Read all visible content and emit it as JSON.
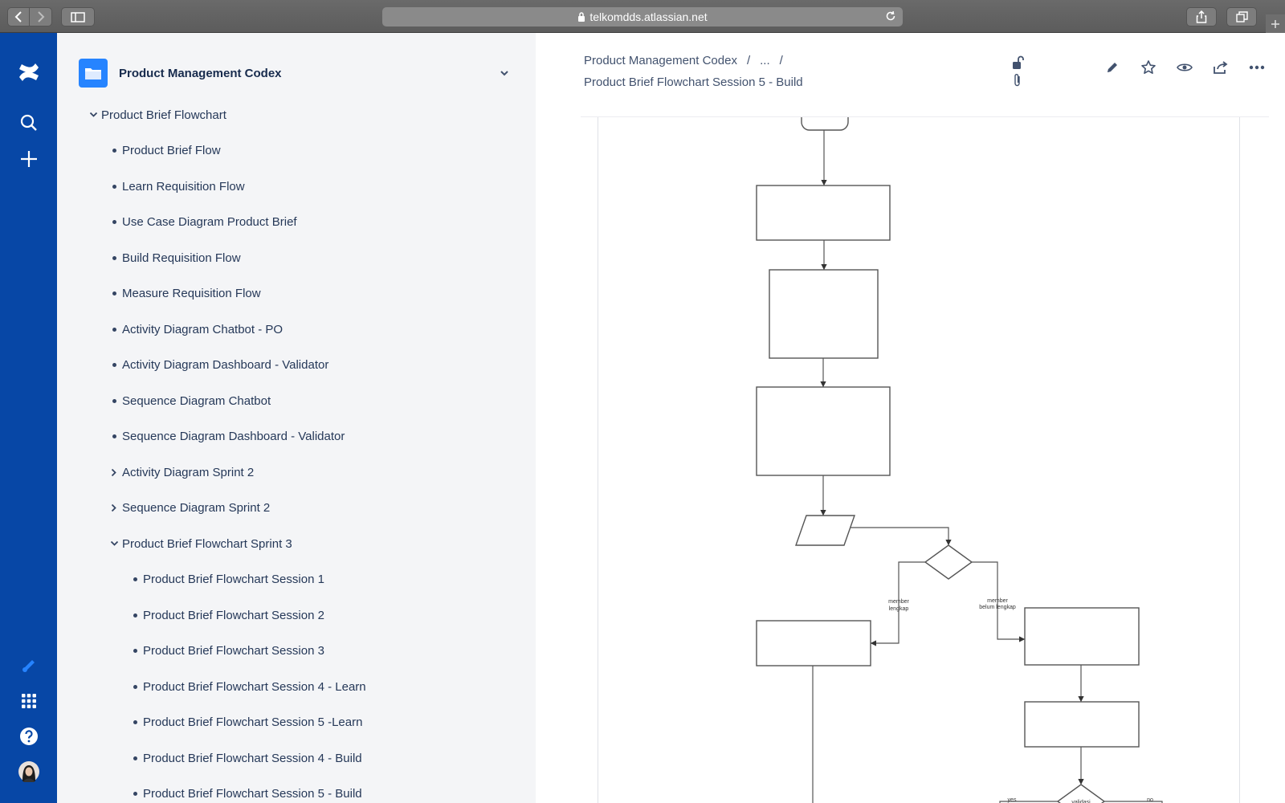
{
  "browser": {
    "url": "telkomdds.atlassian.net"
  },
  "space": {
    "title": "Product Management Codex"
  },
  "tree": [
    {
      "label": "Product Brief Flowchart",
      "level": 0,
      "marker": "chevron-down"
    },
    {
      "label": "Product Brief Flow",
      "level": 1,
      "marker": "bullet"
    },
    {
      "label": "Learn Requisition Flow",
      "level": 1,
      "marker": "bullet"
    },
    {
      "label": "Use Case Diagram Product Brief",
      "level": 1,
      "marker": "bullet"
    },
    {
      "label": "Build Requisition Flow",
      "level": 1,
      "marker": "bullet"
    },
    {
      "label": "Measure Requisition Flow",
      "level": 1,
      "marker": "bullet"
    },
    {
      "label": "Activity Diagram Chatbot - PO",
      "level": 1,
      "marker": "bullet"
    },
    {
      "label": "Activity Diagram Dashboard - Validator",
      "level": 1,
      "marker": "bullet"
    },
    {
      "label": "Sequence Diagram Chatbot",
      "level": 1,
      "marker": "bullet"
    },
    {
      "label": "Sequence Diagram Dashboard - Validator",
      "level": 1,
      "marker": "bullet"
    },
    {
      "label": "Activity Diagram Sprint 2",
      "level": 1,
      "marker": "chevron-right"
    },
    {
      "label": "Sequence Diagram Sprint 2",
      "level": 1,
      "marker": "chevron-right"
    },
    {
      "label": "Product Brief Flowchart Sprint 3",
      "level": 1,
      "marker": "chevron-down"
    },
    {
      "label": "Product Brief Flowchart Session 1",
      "level": 2,
      "marker": "bullet"
    },
    {
      "label": "Product Brief Flowchart Session 2",
      "level": 2,
      "marker": "bullet"
    },
    {
      "label": "Product Brief Flowchart Session 3",
      "level": 2,
      "marker": "bullet"
    },
    {
      "label": "Product Brief Flowchart Session 4 - Learn",
      "level": 2,
      "marker": "bullet"
    },
    {
      "label": "Product Brief Flowchart Session 5 -Learn",
      "level": 2,
      "marker": "bullet"
    },
    {
      "label": "Product Brief Flowchart Session 4 - Build",
      "level": 2,
      "marker": "bullet"
    },
    {
      "label": "Product Brief Flowchart Session 5 - Build",
      "level": 2,
      "marker": "bullet"
    }
  ],
  "breadcrumb": {
    "space": "Product Management Codex",
    "separator": "/",
    "ellipsis": "...",
    "separator2": "/"
  },
  "page": {
    "title": "Product Brief Flowchart Session 5 - Build"
  },
  "diagram": {
    "label_member_lengkap": [
      "member",
      "lengkap"
    ],
    "label_member_belum": [
      "member",
      "belum lengkap"
    ],
    "label_validasi": "validasi",
    "label_yes": "yes",
    "label_no": "no"
  },
  "colors": {
    "global_nav": "#0747a6",
    "sidebar_bg": "#f4f5f7",
    "space_logo": "#2684ff"
  }
}
